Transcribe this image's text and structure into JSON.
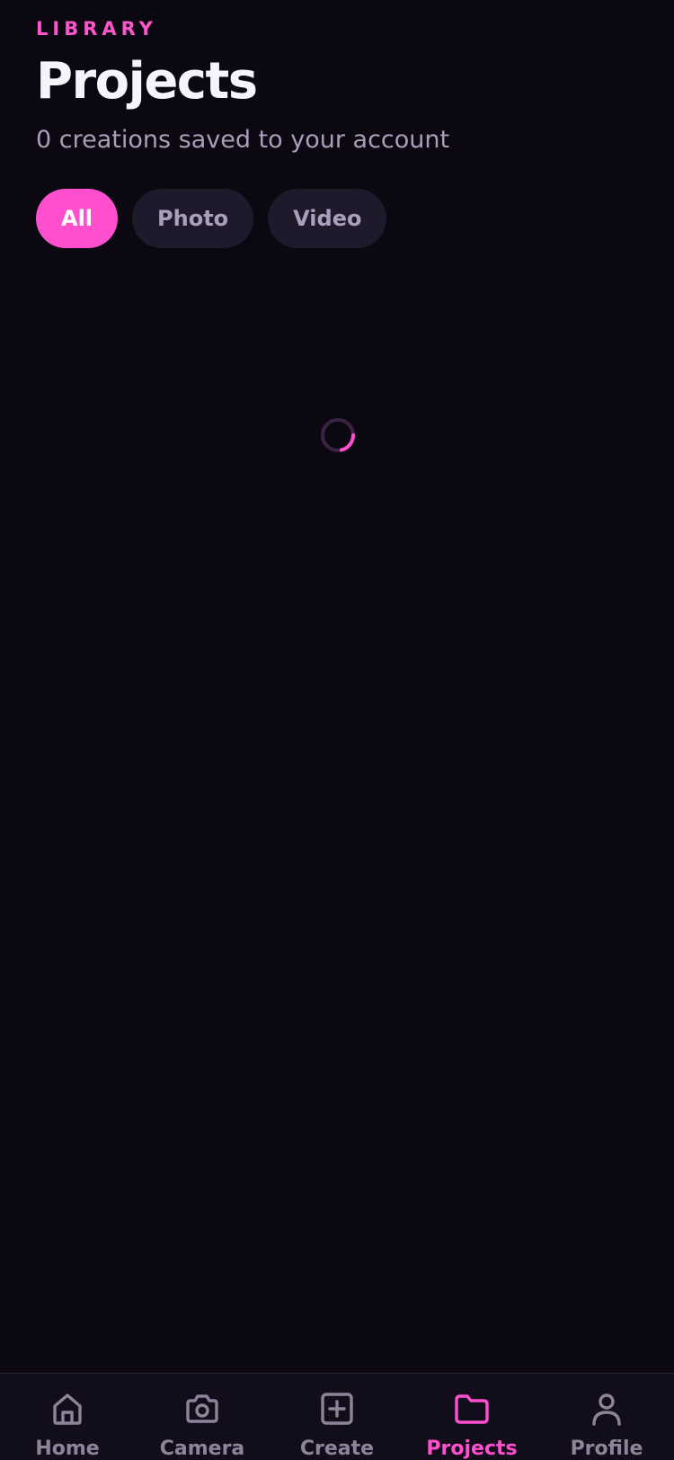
{
  "header": {
    "eyebrow": "LIBRARY",
    "title": "Projects",
    "subtitle": "0 creations saved to your account"
  },
  "filters": [
    {
      "label": "All",
      "active": true
    },
    {
      "label": "Photo",
      "active": false
    },
    {
      "label": "Video",
      "active": false
    }
  ],
  "loading": {
    "icon": "loading-spinner",
    "accent": "#ff4fcf"
  },
  "tabbar": {
    "items": [
      {
        "label": "Home",
        "icon": "home-icon",
        "active": false
      },
      {
        "label": "Camera",
        "icon": "camera-icon",
        "active": false
      },
      {
        "label": "Create",
        "icon": "plus-square-icon",
        "active": false
      },
      {
        "label": "Projects",
        "icon": "folder-icon",
        "active": true
      },
      {
        "label": "Profile",
        "icon": "user-icon",
        "active": false
      }
    ]
  },
  "colors": {
    "background": "#0b0812",
    "accent": "#ff4fcf",
    "chip_bg": "#1e1a2b",
    "muted_text": "#a79fb8",
    "tab_inactive": "#8c8499"
  }
}
